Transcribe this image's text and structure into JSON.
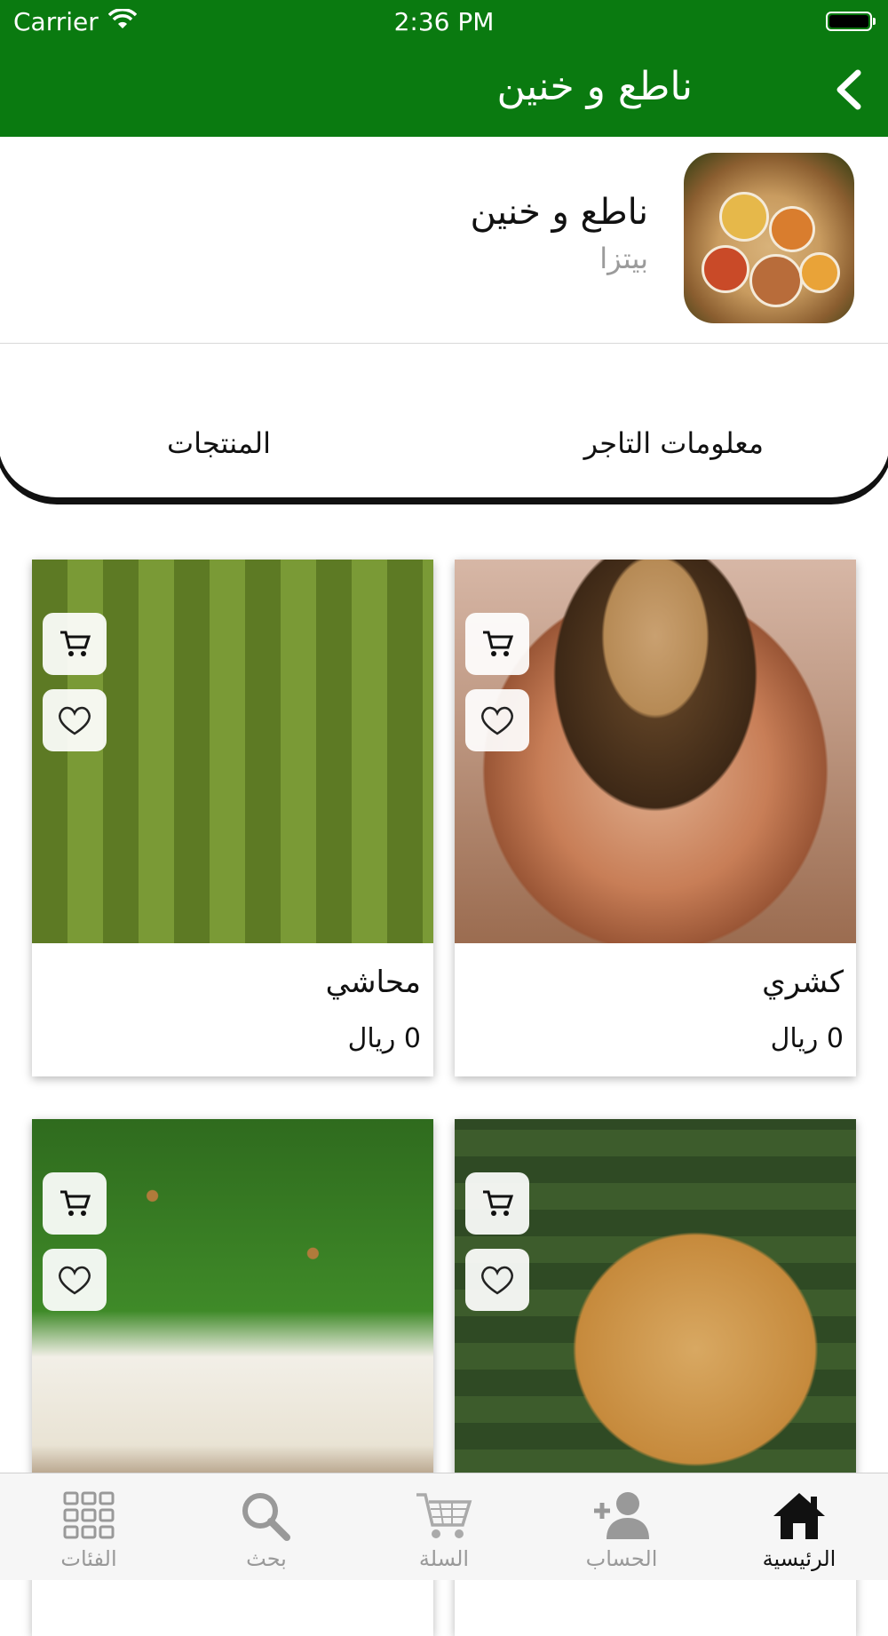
{
  "status_bar": {
    "carrier": "Carrier",
    "time": "2:36 PM"
  },
  "nav": {
    "title": "ناطع و خنين",
    "back_icon": "chevron-left-icon"
  },
  "merchant": {
    "name": "ناطع و خنين",
    "category": "بيتزا"
  },
  "tabs": {
    "info": "معلومات التاجر",
    "products": "المنتجات"
  },
  "products": [
    {
      "name": "كشري",
      "price": "0 ريال"
    },
    {
      "name": "محاشي",
      "price": "0 ريال"
    },
    {
      "name": "",
      "price": ""
    },
    {
      "name": "",
      "price": ""
    }
  ],
  "tab_bar": {
    "items": [
      {
        "label": "الرئيسية",
        "icon": "home-icon",
        "active": true
      },
      {
        "label": "الحساب",
        "icon": "add-user-icon"
      },
      {
        "label": "السلة",
        "icon": "cart-icon"
      },
      {
        "label": "بحث",
        "icon": "search-icon"
      },
      {
        "label": "الفئات",
        "icon": "grid-icon"
      }
    ]
  },
  "colors": {
    "brand_green": "#0a7a10"
  }
}
